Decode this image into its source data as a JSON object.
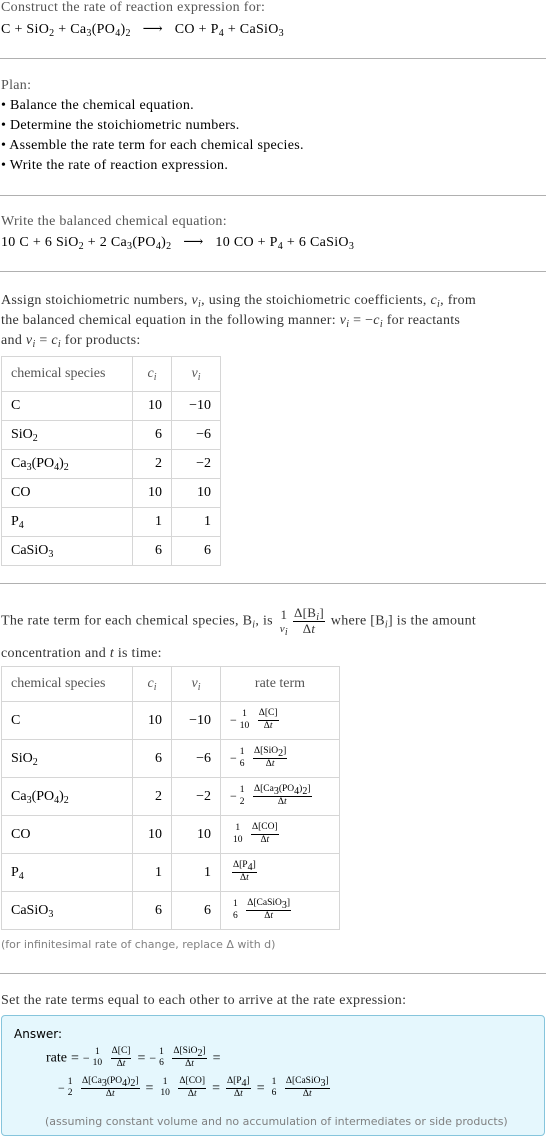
{
  "intro": {
    "label": "Construct the rate of reaction expression for:",
    "reaction": {
      "reactants": [
        "C",
        "SiO2",
        "Ca3(PO4)2"
      ],
      "products": [
        "CO",
        "P4",
        "CaSiO3"
      ],
      "arrow": "⟶",
      "plus": "+"
    }
  },
  "plan": {
    "label": "Plan:",
    "steps": [
      "• Balance the chemical equation.",
      "• Determine the stoichiometric numbers.",
      "• Assemble the rate term for each chemical species.",
      "• Write the rate of reaction expression."
    ]
  },
  "balanced": {
    "label": "Write the balanced chemical equation:",
    "coefficients": {
      "C": "10",
      "SiO2": "6",
      "Ca3(PO4)2": "2",
      "CO": "10",
      "P4": "",
      "CaSiO3": "6"
    }
  },
  "stoich": {
    "text_line1_a": "Assign stoichiometric numbers, ",
    "nu_i": "νi",
    "text_line1_b": ", using the stoichiometric coefficients, ",
    "c_i": "ci",
    "text_line1_c": ", from",
    "text_line2_a": "the balanced chemical equation in the following manner: ",
    "rule_reactants": "νi = −ci",
    "text_line2_b": " for reactants",
    "text_line3_a": "and ",
    "rule_products": "νi = ci",
    "text_line3_b": " for products:",
    "table": {
      "headers": [
        "chemical species",
        "ci",
        "νi"
      ],
      "rows": [
        {
          "species": "C",
          "c": "10",
          "nu": "−10"
        },
        {
          "species": "SiO2",
          "c": "6",
          "nu": "−6"
        },
        {
          "species": "Ca3(PO4)2",
          "c": "2",
          "nu": "−2"
        },
        {
          "species": "CO",
          "c": "10",
          "nu": "10"
        },
        {
          "species": "P4",
          "c": "1",
          "nu": "1"
        },
        {
          "species": "CaSiO3",
          "c": "6",
          "nu": "6"
        }
      ]
    }
  },
  "rateterm": {
    "text_a": "The rate term for each chemical species, B",
    "text_b": ", is ",
    "text_c": " where [B",
    "text_d": "] is the amount",
    "text_line2_a": "concentration and ",
    "t": "t",
    "text_line2_b": " is time:",
    "frac_one": "1",
    "frac_nu": "ν",
    "frac_delta_num": "Δ[B",
    "frac_delta_den": "Δt",
    "table": {
      "headers": [
        "chemical species",
        "ci",
        "νi",
        "rate term"
      ],
      "rows": [
        {
          "species": "C",
          "c": "10",
          "nu": "−10",
          "sign": "−",
          "coef": "10",
          "conc": "Δ[C]"
        },
        {
          "species": "SiO2",
          "c": "6",
          "nu": "−6",
          "sign": "−",
          "coef": "6",
          "conc": "Δ[SiO2]"
        },
        {
          "species": "Ca3(PO4)2",
          "c": "2",
          "nu": "−2",
          "sign": "−",
          "coef": "2",
          "conc": "Δ[Ca3(PO4)2]"
        },
        {
          "species": "CO",
          "c": "10",
          "nu": "10",
          "sign": "",
          "coef": "10",
          "conc": "Δ[CO]"
        },
        {
          "species": "P4",
          "c": "1",
          "nu": "1",
          "sign": "",
          "coef": "",
          "conc": "Δ[P4]"
        },
        {
          "species": "CaSiO3",
          "c": "6",
          "nu": "6",
          "sign": "",
          "coef": "6",
          "conc": "Δ[CaSiO3]"
        }
      ]
    },
    "note": "(for infinitesimal rate of change, replace Δ with d)"
  },
  "final": {
    "label": "Set the rate terms equal to each other to arrive at the rate expression:",
    "answer_label": "Answer:",
    "rate_word": "rate",
    "eq": "=",
    "one": "1",
    "dt": "Δt",
    "note": "(assuming constant volume and no accumulation of intermediates or side products)"
  },
  "colors": {
    "label_gray": "#555555",
    "rule_gray": "#b0b0b0",
    "answer_bg": "#e5f7fd",
    "answer_border": "#86c5dc",
    "note_gray": "#808080"
  }
}
